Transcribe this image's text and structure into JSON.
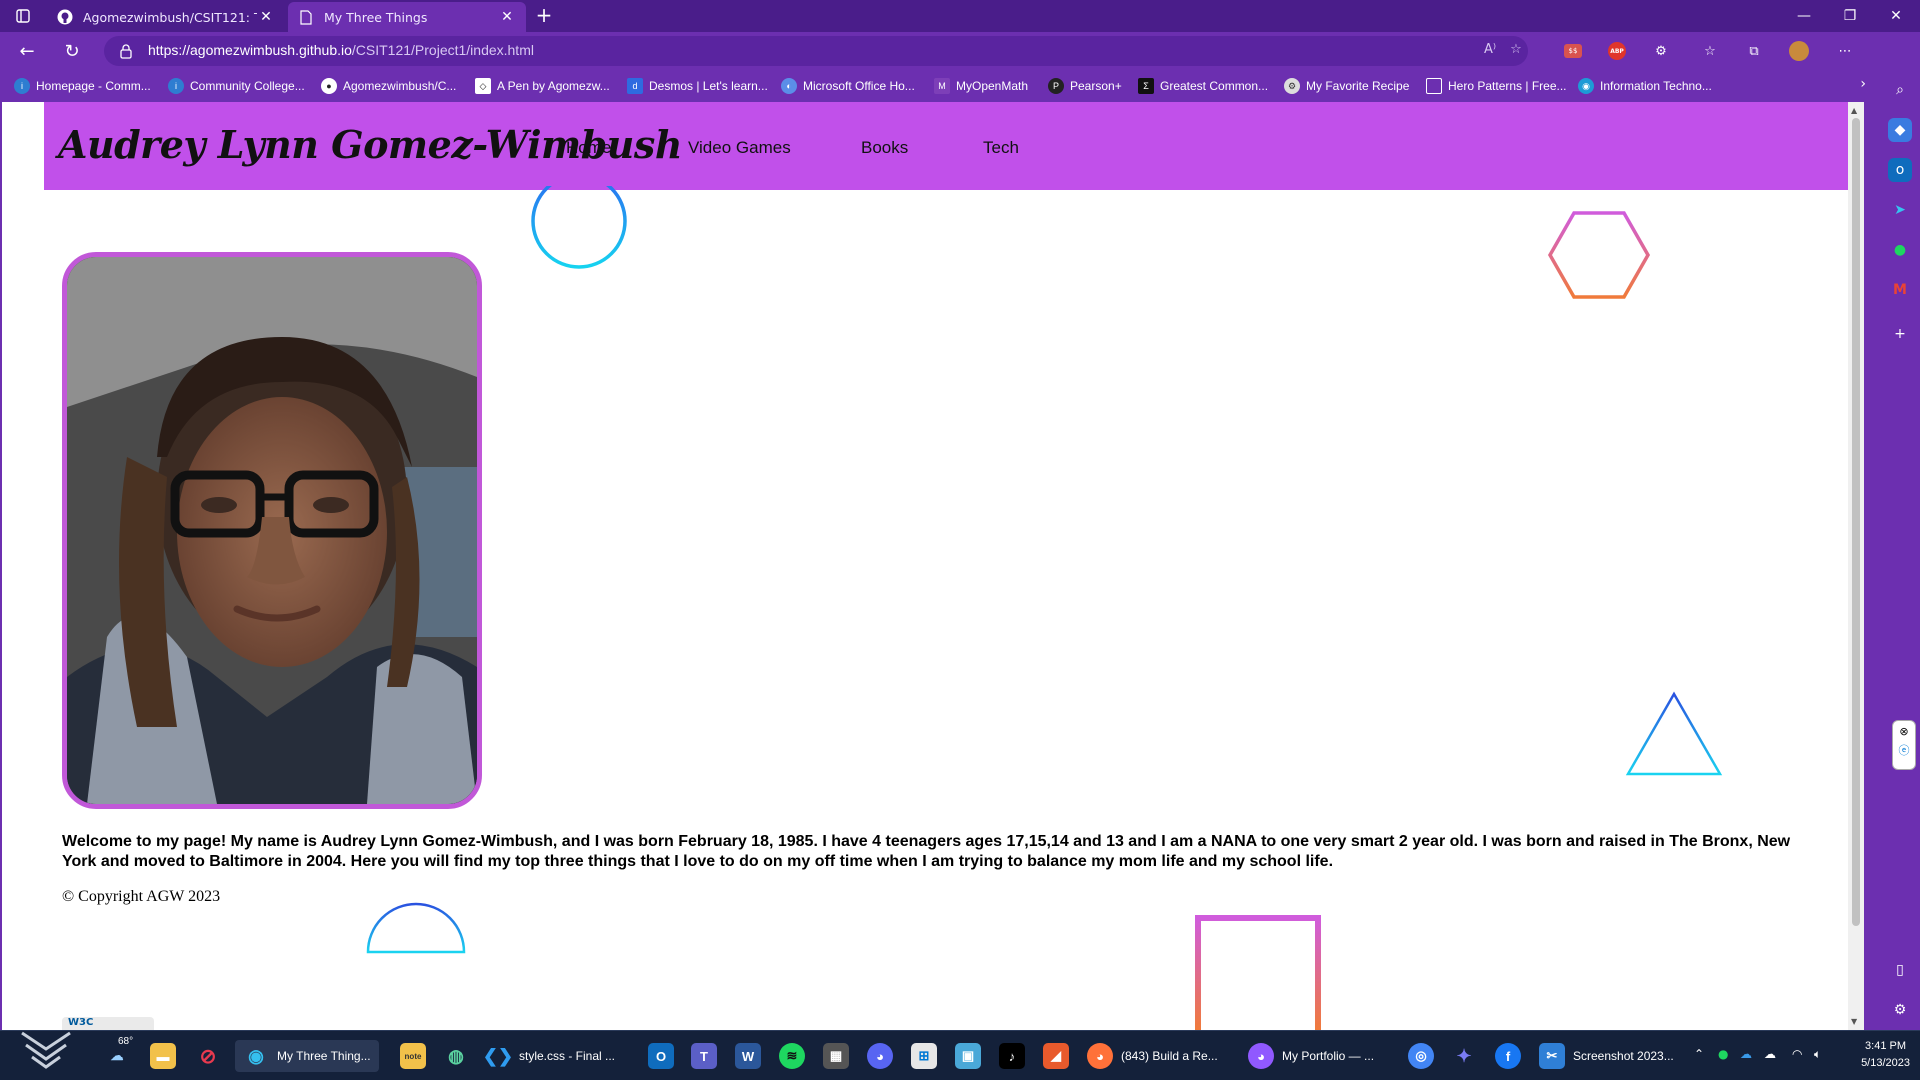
{
  "browser": {
    "tabs": [
      {
        "title": "Agomezwimbush/CSIT121: This i",
        "active": false
      },
      {
        "title": "My Three Things",
        "active": true
      }
    ],
    "url_host": "https://agomezwimbush.github.io",
    "url_path": "/CSIT121/Project1/index.html",
    "bookmarks": [
      "Homepage - Comm...",
      "Community College...",
      "Agomezwimbush/C...",
      "A Pen by Agomezw...",
      "Desmos | Let's learn...",
      "Microsoft Office Ho...",
      "MyOpenMath",
      "Pearson+",
      "Greatest Common...",
      "My Favorite Recipe",
      "Hero Patterns | Free...",
      "Information Techno..."
    ],
    "extensions": [
      "read-aloud-icon",
      "favorite-add-icon",
      "ext-coupon-icon",
      "adblock-icon",
      "extensions-icon",
      "favorites-icon",
      "collections-icon",
      "profile-avatar",
      "more-icon"
    ]
  },
  "page": {
    "site_title": "Audrey Lynn Gomez-Wimbush",
    "nav": [
      "Home",
      "Video Games",
      "Books",
      "Tech"
    ],
    "intro": "Welcome to my page! My name is Audrey Lynn Gomez-Wimbush, and I was born February 18, 1985. I have 4 teenagers ages 17,15,14 and 13 and I am a NANA to one very smart 2 year old. I was born and raised in The Bronx, New York and moved to Baltimore in 2004. Here you will find my top three things that I love to do on my off time when I am trying to balance my mom life and my school life.",
    "copyright": "© Copyright AGW 2023",
    "header_color": "#c150ea"
  },
  "taskbar": {
    "weather": "68°",
    "items": [
      {
        "label": "My Three Thing...",
        "icon": "edge-icon",
        "active": true
      },
      {
        "label": "style.css - Final ...",
        "icon": "vscode-icon",
        "active": false
      },
      {
        "label": "(843) Build a Re...",
        "icon": "firefox-icon",
        "active": false
      },
      {
        "label": "My Portfolio — ...",
        "icon": "firefox-dev-icon",
        "active": false
      },
      {
        "label": "Screenshot 2023...",
        "icon": "snip-icon",
        "active": false
      }
    ],
    "time": "3:41 PM",
    "date": "5/13/2023"
  }
}
